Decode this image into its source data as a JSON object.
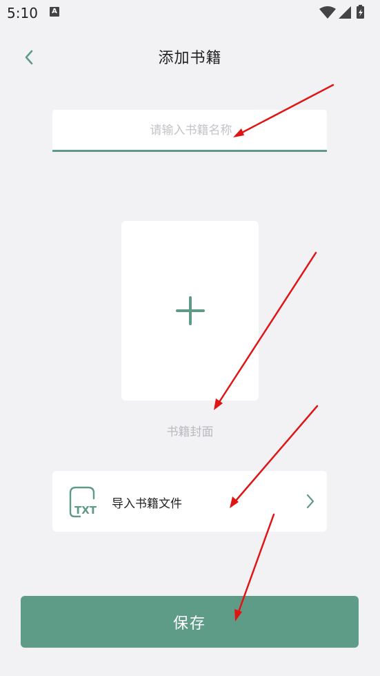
{
  "status_bar": {
    "time": "5:10",
    "notification_icon": "A"
  },
  "header": {
    "title": "添加书籍"
  },
  "name_input": {
    "placeholder": "请输入书籍名称",
    "value": ""
  },
  "cover": {
    "label": "书籍封面"
  },
  "import": {
    "label": "导入书籍文件",
    "icon_text": "TXT"
  },
  "save_button": {
    "label": "保存"
  },
  "colors": {
    "accent": "#5f9c87",
    "annotation": "#e01414"
  }
}
